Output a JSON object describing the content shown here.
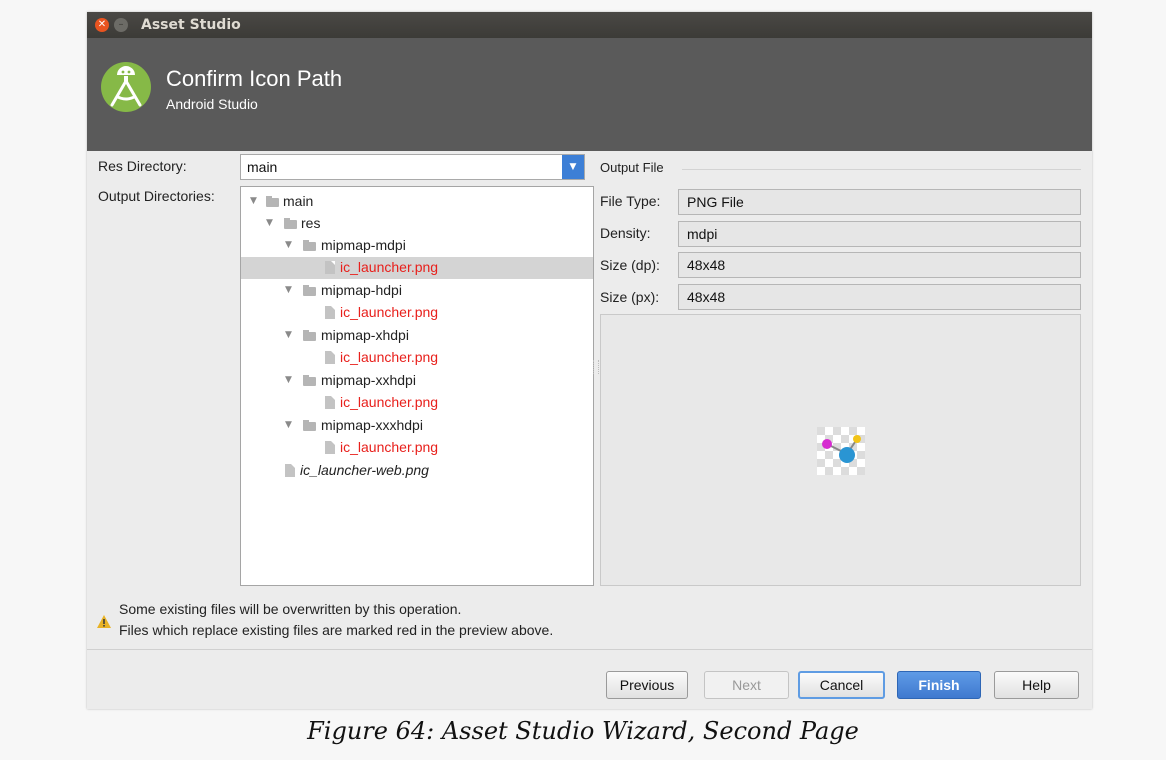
{
  "window": {
    "title": "Asset Studio"
  },
  "header": {
    "title": "Confirm Icon Path",
    "subtitle": "Android Studio"
  },
  "form": {
    "res_directory_label": "Res Directory:",
    "res_directory_value": "main",
    "output_directories_label": "Output Directories:"
  },
  "tree": {
    "items": [
      {
        "label": "main"
      },
      {
        "label": "res"
      },
      {
        "label": "mipmap-mdpi"
      },
      {
        "label": "ic_launcher.png",
        "overwritten": true,
        "selected": true
      },
      {
        "label": "mipmap-hdpi"
      },
      {
        "label": "ic_launcher.png",
        "overwritten": true
      },
      {
        "label": "mipmap-xhdpi"
      },
      {
        "label": "ic_launcher.png",
        "overwritten": true
      },
      {
        "label": "mipmap-xxhdpi"
      },
      {
        "label": "ic_launcher.png",
        "overwritten": true
      },
      {
        "label": "mipmap-xxxhdpi"
      },
      {
        "label": "ic_launcher.png",
        "overwritten": true
      },
      {
        "label": "ic_launcher-web.png"
      }
    ]
  },
  "output_file": {
    "section_title": "Output File",
    "file_type_label": "File Type:",
    "file_type_value": "PNG File",
    "density_label": "Density:",
    "density_value": "mdpi",
    "size_dp_label": "Size (dp):",
    "size_dp_value": "48x48",
    "size_px_label": "Size (px):",
    "size_px_value": "48x48"
  },
  "warning": {
    "line1": "Some existing files will be overwritten by this operation.",
    "line2": "Files which replace existing files are marked red in the preview above."
  },
  "buttons": {
    "previous": "Previous",
    "next": "Next",
    "cancel": "Cancel",
    "finish": "Finish",
    "help": "Help"
  },
  "caption": "Figure 64: Asset Studio Wizard, Second Page",
  "colors": {
    "accent": "#3d7fd6",
    "overwritten_text": "#e8201c",
    "header_bg": "#5a5a5a"
  }
}
